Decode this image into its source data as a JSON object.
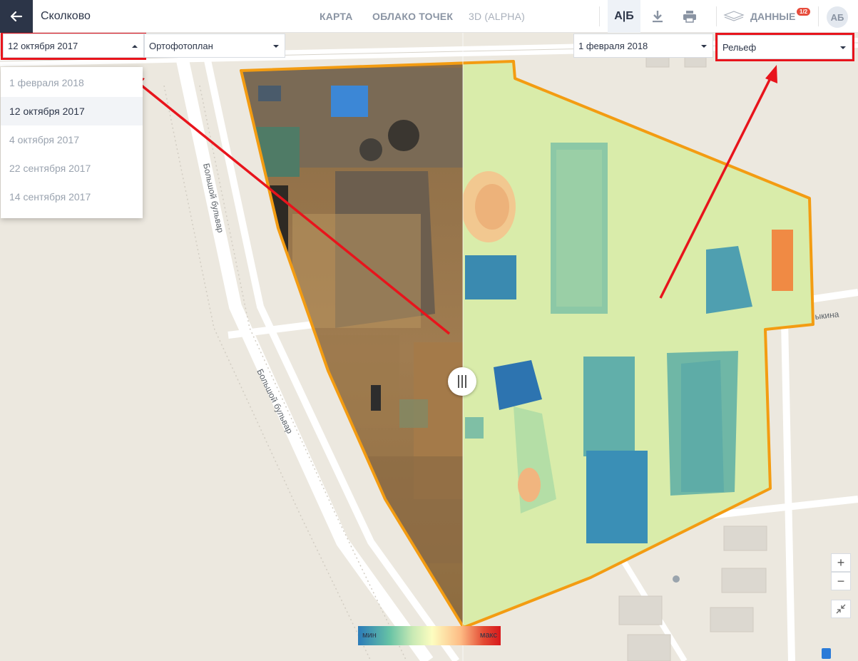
{
  "header": {
    "project_title": "Сколково",
    "tabs": [
      {
        "label": "КАРТА"
      },
      {
        "label": "ОБЛАКО ТОЧЕК"
      },
      {
        "label": "3D (ALPHA)"
      }
    ],
    "compare_label": "А|Б",
    "data_label": "ДАННЫЕ",
    "data_badge": "1/2",
    "avatar_initials": "АБ"
  },
  "left_panel": {
    "date_value": "12 октября 2017",
    "layer_value": "Ортофотоплан",
    "date_options": [
      {
        "label": "1 февраля 2018",
        "selected": false
      },
      {
        "label": "12 октября 2017",
        "selected": true
      },
      {
        "label": "4 октября 2017",
        "selected": false
      },
      {
        "label": "22 сентября 2017",
        "selected": false
      },
      {
        "label": "14 сентября 2017",
        "selected": false
      }
    ]
  },
  "right_panel": {
    "date_value": "1 февраля 2018",
    "layer_value": "Рельеф"
  },
  "map": {
    "street_labels": [
      "Большой бульвар",
      "Большой бульвар",
      "ыкина"
    ]
  },
  "legend": {
    "min_label": "мин",
    "max_label": "макс"
  },
  "controls": {
    "zoom_in": "+",
    "zoom_out": "−"
  },
  "colors": {
    "boundary": "#f39c12",
    "highlight": "#e8141c",
    "header_dark": "#2c3548"
  }
}
